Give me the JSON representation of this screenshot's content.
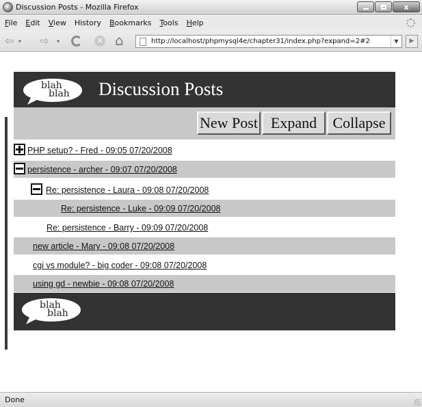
{
  "window": {
    "title": "Discussion Posts - Mozilla Firefox",
    "buttons": {
      "minimize": "minimize",
      "maximize": "maximize",
      "close": "x"
    }
  },
  "menubar": {
    "items": [
      {
        "label": "File",
        "accel": "F",
        "rest": "ile"
      },
      {
        "label": "Edit",
        "accel": "E",
        "rest": "dit"
      },
      {
        "label": "View",
        "accel": "V",
        "rest": "iew"
      },
      {
        "label": "History",
        "accel": "",
        "rest": "History"
      },
      {
        "label": "Bookmarks",
        "accel": "B",
        "rest": "ookmarks"
      },
      {
        "label": "Tools",
        "accel": "T",
        "rest": "ools"
      },
      {
        "label": "Help",
        "accel": "H",
        "rest": "elp"
      }
    ]
  },
  "navbar": {
    "url": "http://localhost/phpmysql4e/chapter31/index.php?expand=2#2",
    "icons": [
      "back-icon",
      "forward-icon",
      "reload-icon",
      "stop-icon",
      "home-icon",
      "go-icon"
    ]
  },
  "page": {
    "logo": {
      "line1": "blah",
      "line2": "blah"
    },
    "title": "Discussion Posts",
    "buttons": {
      "new_post": "New Post",
      "expand": "Expand",
      "collapse": "Collapse"
    },
    "posts": [
      {
        "text": "PHP setup? - Fred - 09:05 07/20/2008",
        "toggle": "expand"
      },
      {
        "text": "persistence - archer - 09:07 07/20/2008",
        "toggle": "collapse"
      },
      {
        "text": "Re: persistence - Laura - 09:08 07/20/2008",
        "toggle": "collapse"
      },
      {
        "text": "Re: persistence - Luke - 09:09 07/20/2008",
        "toggle": ""
      },
      {
        "text": "Re: persistence - Barry - 09:09 07/20/2008",
        "toggle": ""
      },
      {
        "text": "new article - Mary - 09:08 07/20/2008",
        "toggle": ""
      },
      {
        "text": "cgi vs module? - big coder - 09:08 07/20/2008",
        "toggle": ""
      },
      {
        "text": "using gd - newbie - 09:08 07/20/2008",
        "toggle": ""
      }
    ]
  },
  "statusbar": {
    "text": "Done"
  }
}
